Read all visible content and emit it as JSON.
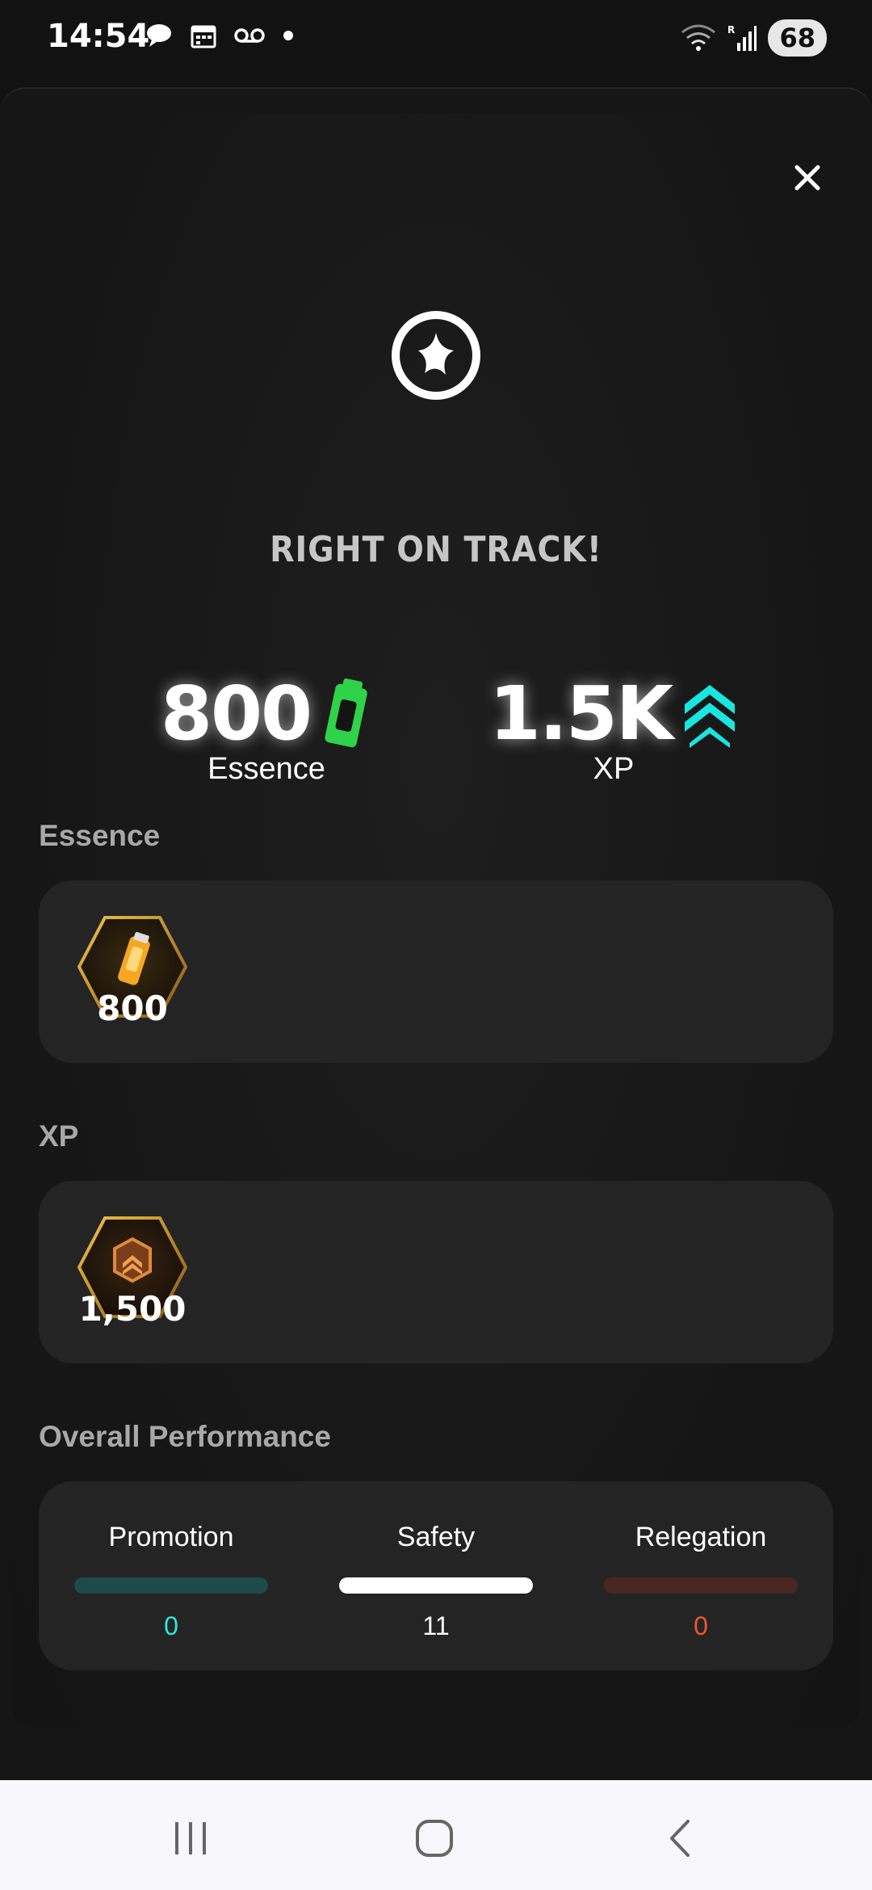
{
  "status_bar": {
    "time": "14:54",
    "battery": "68"
  },
  "popup": {
    "headline": "RIGHT ON TRACK!",
    "stats": [
      {
        "value": "800",
        "label": "Essence",
        "icon": "essence-canister-icon",
        "color": "#2fd34a"
      },
      {
        "value": "1.5K",
        "label": "XP",
        "icon": "xp-chevrons-icon",
        "color": "#19e6e0"
      }
    ]
  },
  "essence_section": {
    "title": "Essence",
    "reward_amount": "800",
    "reward_icon": "essence-hex-badge-icon"
  },
  "xp_section": {
    "title": "XP",
    "reward_amount": "1,500",
    "reward_icon": "xp-hex-badge-icon"
  },
  "performance": {
    "title": "Overall Performance",
    "columns": [
      {
        "label": "Promotion",
        "value": "0",
        "bar_color": "#1e4a4a",
        "value_color": "#2ee6e0"
      },
      {
        "label": "Safety",
        "value": "11",
        "bar_color": "#ffffff",
        "value_color": "#ffffff"
      },
      {
        "label": "Relegation",
        "value": "0",
        "bar_color": "#4a2622",
        "value_color": "#f0552e"
      }
    ]
  },
  "nav": {
    "recents_icon": "recents-icon",
    "home_icon": "home-icon",
    "back_icon": "back-icon"
  }
}
